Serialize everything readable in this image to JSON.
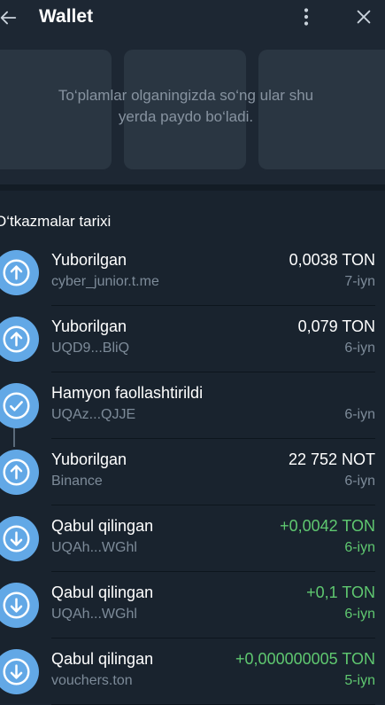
{
  "header": {
    "title": "Wallet",
    "back_icon": "arrow-left-icon",
    "more_icon": "more-vertical-icon",
    "close_icon": "close-icon"
  },
  "collectibles": {
    "empty_line1": "To‘plamlar olganingizda so‘ng ular shu",
    "empty_line2": "yerda paydo bo‘ladi."
  },
  "history": {
    "title": "O‘tkazmalar tarixi",
    "transactions": [
      {
        "title": "Yuborilgan",
        "subtitle": "cyber_junior.t.me",
        "amount": "0,0038 TON",
        "date": "7-iyn",
        "direction": "out",
        "icon": "arrow-up-icon"
      },
      {
        "title": "Yuborilgan",
        "subtitle": "UQD9...BliQ",
        "amount": "0,079 TON",
        "date": "6-iyn",
        "direction": "out",
        "icon": "arrow-up-icon"
      },
      {
        "title": "Hamyon faollashtirildi",
        "subtitle": "UQAz...QJJE",
        "amount": "",
        "date": "6-iyn",
        "direction": "activate",
        "icon": "checkmark-icon"
      },
      {
        "title": "Yuborilgan",
        "subtitle": "Binance",
        "amount": "22 752 NOT",
        "date": "6-iyn",
        "direction": "out",
        "icon": "arrow-up-icon"
      },
      {
        "title": "Qabul qilingan",
        "subtitle": "UQAh...WGhl",
        "amount": "+0,0042 TON",
        "date": "6-iyn",
        "direction": "in",
        "icon": "arrow-down-icon"
      },
      {
        "title": "Qabul qilingan",
        "subtitle": "UQAh...WGhl",
        "amount": "+0,1 TON",
        "date": "6-iyn",
        "direction": "in",
        "icon": "arrow-down-icon"
      },
      {
        "title": "Qabul qilingan",
        "subtitle": "vouchers.ton",
        "amount": "+0,000000005 TON",
        "date": "5-iyn",
        "direction": "in",
        "icon": "arrow-down-icon"
      }
    ]
  },
  "colors": {
    "icon_circle": "#62a8e6",
    "incoming": "#5fc870",
    "background": "#19232e"
  }
}
